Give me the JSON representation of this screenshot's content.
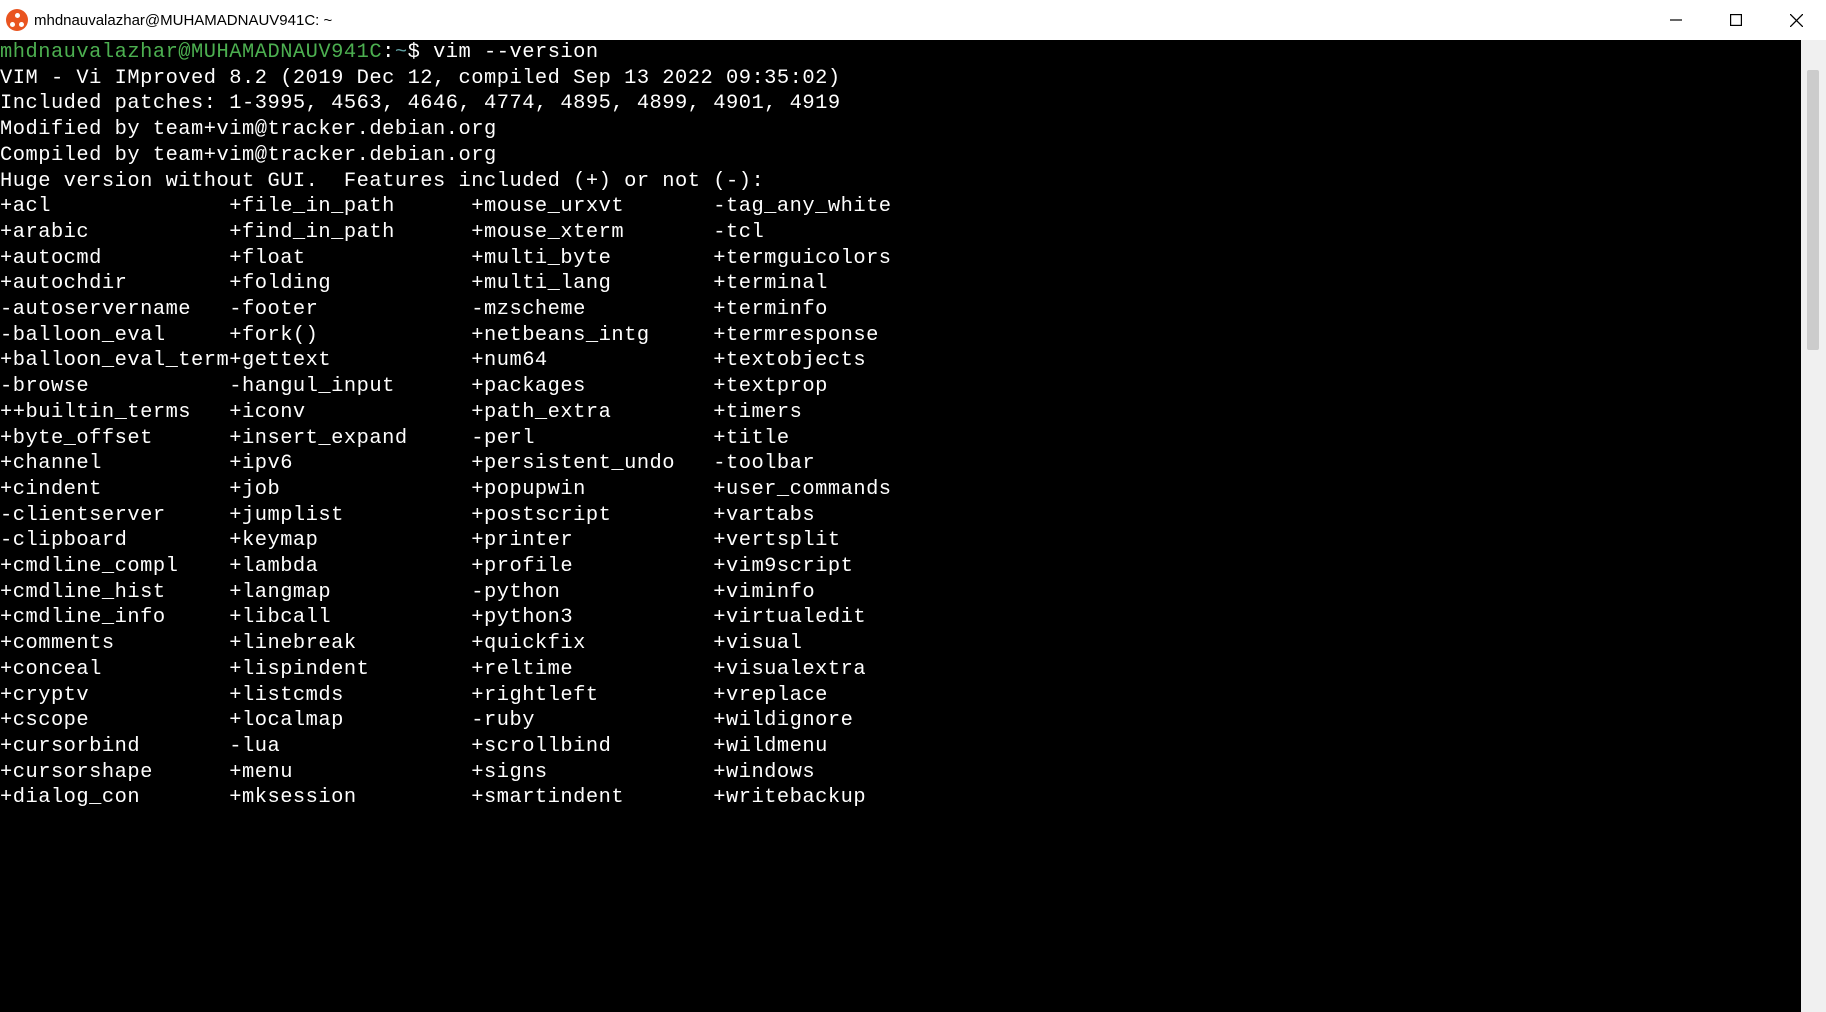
{
  "window": {
    "title": "mhdnauvalazhar@MUHAMADNAUV941C: ~"
  },
  "prompt": {
    "userhost": "mhdnauvalazhar@MUHAMADNAUV941C",
    "colon": ":",
    "path": "~",
    "dollar": "$",
    "command": "vim --version"
  },
  "output": {
    "header": [
      "VIM - Vi IMproved 8.2 (2019 Dec 12, compiled Sep 13 2022 09:35:02)",
      "Included patches: 1-3995, 4563, 4646, 4774, 4895, 4899, 4901, 4919",
      "Modified by team+vim@tracker.debian.org",
      "Compiled by team+vim@tracker.debian.org",
      "Huge version without GUI.  Features included (+) or not (-):"
    ],
    "features": {
      "col1": [
        "+acl",
        "+arabic",
        "+autocmd",
        "+autochdir",
        "-autoservername",
        "-balloon_eval",
        "+balloon_eval_term",
        "-browse",
        "++builtin_terms",
        "+byte_offset",
        "+channel",
        "+cindent",
        "-clientserver",
        "-clipboard",
        "+cmdline_compl",
        "+cmdline_hist",
        "+cmdline_info",
        "+comments",
        "+conceal",
        "+cryptv",
        "+cscope",
        "+cursorbind",
        "+cursorshape",
        "+dialog_con"
      ],
      "col2": [
        "+file_in_path",
        "+find_in_path",
        "+float",
        "+folding",
        "-footer",
        "+fork()",
        "+gettext",
        "-hangul_input",
        "+iconv",
        "+insert_expand",
        "+ipv6",
        "+job",
        "+jumplist",
        "+keymap",
        "+lambda",
        "+langmap",
        "+libcall",
        "+linebreak",
        "+lispindent",
        "+listcmds",
        "+localmap",
        "-lua",
        "+menu",
        "+mksession"
      ],
      "col3": [
        "+mouse_urxvt",
        "+mouse_xterm",
        "+multi_byte",
        "+multi_lang",
        "-mzscheme",
        "+netbeans_intg",
        "+num64",
        "+packages",
        "+path_extra",
        "-perl",
        "+persistent_undo",
        "+popupwin",
        "+postscript",
        "+printer",
        "+profile",
        "-python",
        "+python3",
        "+quickfix",
        "+reltime",
        "+rightleft",
        "-ruby",
        "+scrollbind",
        "+signs",
        "+smartindent"
      ],
      "col4": [
        "-tag_any_white",
        "-tcl",
        "+termguicolors",
        "+terminal",
        "+terminfo",
        "+termresponse",
        "+textobjects",
        "+textprop",
        "+timers",
        "+title",
        "-toolbar",
        "+user_commands",
        "+vartabs",
        "+vertsplit",
        "+vim9script",
        "+viminfo",
        "+virtualedit",
        "+visual",
        "+visualextra",
        "+vreplace",
        "+wildignore",
        "+wildmenu",
        "+windows",
        "+writebackup"
      ]
    }
  },
  "colwidths": {
    "c1": 18,
    "c2": 19,
    "c3": 19
  }
}
